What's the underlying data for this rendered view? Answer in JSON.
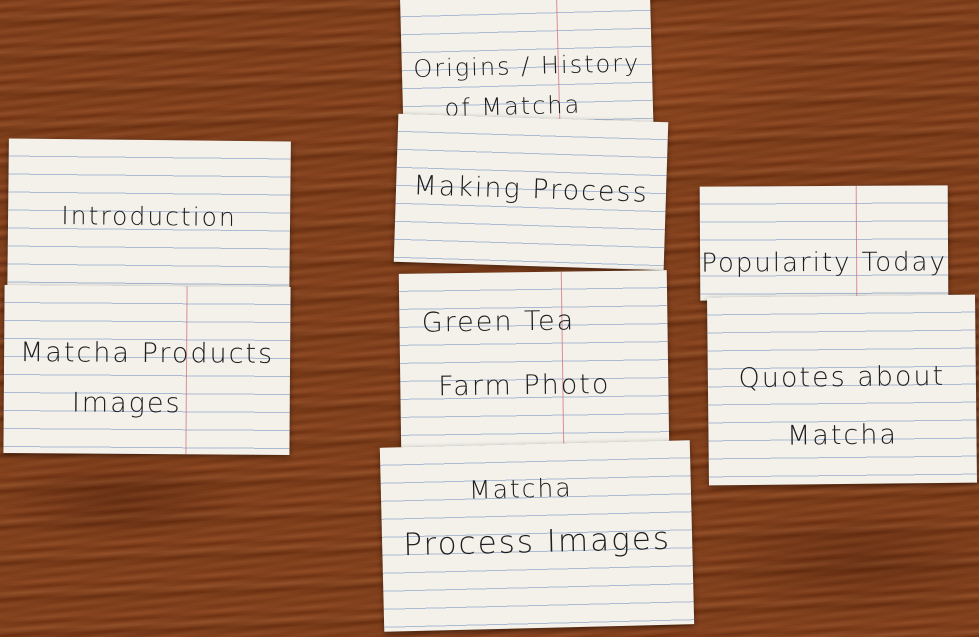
{
  "cards": {
    "origins": {
      "line1": "Origins / History",
      "line2": "of Matcha"
    },
    "introduction": {
      "line1": "Introduction"
    },
    "making": {
      "line1": "Making Process"
    },
    "popularity": {
      "line1": "Popularity Today"
    },
    "products": {
      "line1": "Matcha Products",
      "line2": "Images"
    },
    "farm": {
      "line1": "Green Tea",
      "line2": "Farm Photo"
    },
    "quotes": {
      "line1": "Quotes about",
      "line2": "Matcha"
    },
    "process_images": {
      "line1": "Matcha",
      "line2": "Process Images"
    }
  },
  "colors": {
    "wood": "#7d3c19",
    "card": "#f3f1ea",
    "ruled_line": "#6e8cbe",
    "margin_line": "#d26e78",
    "ink": "#1d1d1f"
  }
}
